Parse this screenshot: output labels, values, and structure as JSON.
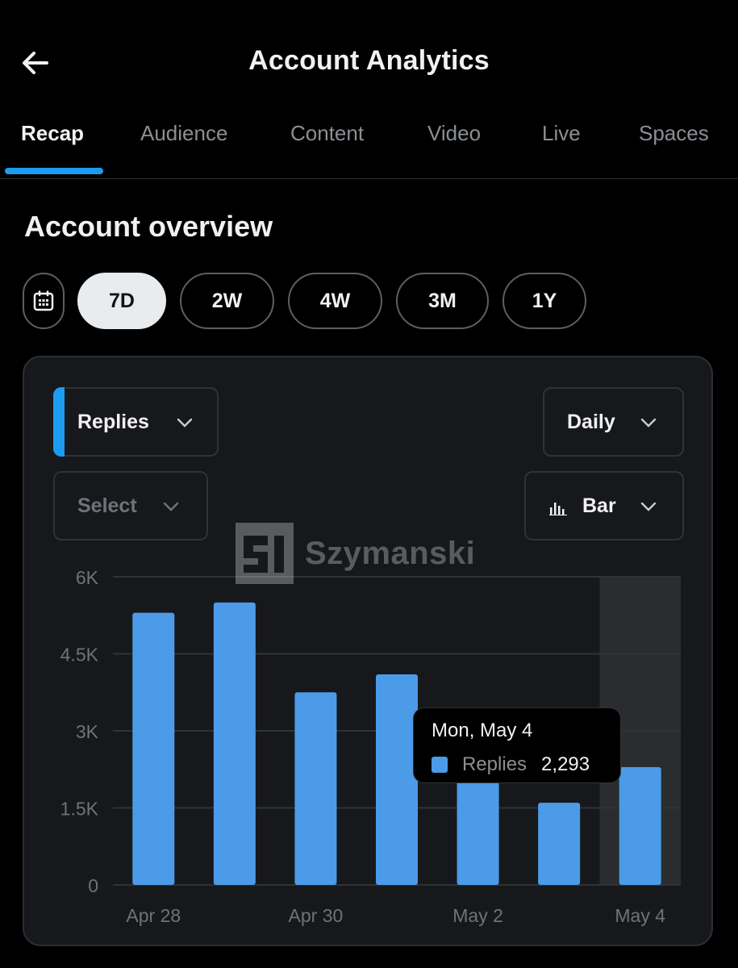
{
  "header": {
    "title": "Account Analytics",
    "back_icon": "arrow-left-icon"
  },
  "tabs": [
    {
      "label": "Recap",
      "active": true
    },
    {
      "label": "Audience",
      "active": false
    },
    {
      "label": "Content",
      "active": false
    },
    {
      "label": "Video",
      "active": false
    },
    {
      "label": "Live",
      "active": false
    },
    {
      "label": "Spaces",
      "active": false
    }
  ],
  "overview": {
    "title": "Account overview",
    "calendar_icon": "calendar-icon",
    "ranges": [
      {
        "label": "7D",
        "selected": true
      },
      {
        "label": "2W",
        "selected": false
      },
      {
        "label": "4W",
        "selected": false
      },
      {
        "label": "3M",
        "selected": false
      },
      {
        "label": "1Y",
        "selected": false
      }
    ]
  },
  "controls": {
    "metric": "Replies",
    "compare": "Select",
    "granularity": "Daily",
    "chart_type": "Bar",
    "chart_type_icon": "bar-chart-icon"
  },
  "watermark": {
    "text": "Szymanski"
  },
  "tooltip": {
    "date": "Mon, May 4",
    "series": "Replies",
    "value": "2,293"
  },
  "colors": {
    "accent": "#1d9bf0",
    "bar": "#4c9be8",
    "background": "#000000",
    "card": "#16181c"
  },
  "chart_data": {
    "type": "bar",
    "categories": [
      "Apr 28",
      "Apr 29",
      "Apr 30",
      "May 1",
      "May 2",
      "May 3",
      "May 4"
    ],
    "x_tick_labels": [
      "Apr 28",
      "Apr 30",
      "May 2",
      "May 4"
    ],
    "series": [
      {
        "name": "Replies",
        "values": [
          5300,
          5500,
          3750,
          4100,
          2100,
          1600,
          2293
        ]
      }
    ],
    "y_ticks": [
      "6K",
      "4.5K",
      "3K",
      "1.5K",
      "0"
    ],
    "y_tick_values": [
      6000,
      4500,
      3000,
      1500,
      0
    ],
    "ylim": [
      0,
      6000
    ],
    "grid": true,
    "highlighted_category": "May 4"
  }
}
